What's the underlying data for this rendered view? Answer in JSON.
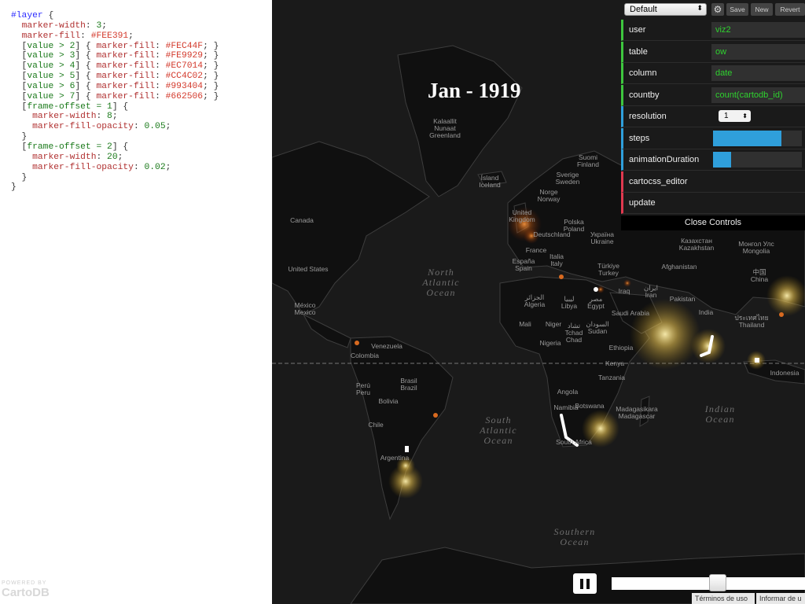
{
  "editor": {
    "lines": [
      [
        [
          "sel",
          "#layer"
        ],
        [
          "pn",
          " {"
        ]
      ],
      [
        [
          "pn",
          "  "
        ],
        [
          "kw",
          "marker-width"
        ],
        [
          "pn",
          ": "
        ],
        [
          "num",
          "3"
        ],
        [
          "pn",
          ";"
        ]
      ],
      [
        [
          "pn",
          "  "
        ],
        [
          "kw",
          "marker-fill"
        ],
        [
          "pn",
          ": "
        ],
        [
          "col",
          "#FEE391"
        ],
        [
          "pn",
          ";"
        ]
      ],
      [
        [
          "pn",
          "  ["
        ],
        [
          "num",
          "value > 2"
        ],
        [
          "pn",
          "] { "
        ],
        [
          "kw",
          "marker-fill"
        ],
        [
          "pn",
          ": "
        ],
        [
          "col",
          "#FEC44F"
        ],
        [
          "pn",
          "; }"
        ]
      ],
      [
        [
          "pn",
          "  ["
        ],
        [
          "num",
          "value > 3"
        ],
        [
          "pn",
          "] { "
        ],
        [
          "kw",
          "marker-fill"
        ],
        [
          "pn",
          ": "
        ],
        [
          "col",
          "#FE9929"
        ],
        [
          "pn",
          "; }"
        ]
      ],
      [
        [
          "pn",
          "  ["
        ],
        [
          "num",
          "value > 4"
        ],
        [
          "pn",
          "] { "
        ],
        [
          "kw",
          "marker-fill"
        ],
        [
          "pn",
          ": "
        ],
        [
          "col",
          "#EC7014"
        ],
        [
          "pn",
          "; }"
        ]
      ],
      [
        [
          "pn",
          "  ["
        ],
        [
          "num",
          "value > 5"
        ],
        [
          "pn",
          "] { "
        ],
        [
          "kw",
          "marker-fill"
        ],
        [
          "pn",
          ": "
        ],
        [
          "col",
          "#CC4C02"
        ],
        [
          "pn",
          "; }"
        ]
      ],
      [
        [
          "pn",
          "  ["
        ],
        [
          "num",
          "value > 6"
        ],
        [
          "pn",
          "] { "
        ],
        [
          "kw",
          "marker-fill"
        ],
        [
          "pn",
          ": "
        ],
        [
          "col",
          "#993404"
        ],
        [
          "pn",
          "; }"
        ]
      ],
      [
        [
          "pn",
          "  ["
        ],
        [
          "num",
          "value > 7"
        ],
        [
          "pn",
          "] { "
        ],
        [
          "kw",
          "marker-fill"
        ],
        [
          "pn",
          ": "
        ],
        [
          "col",
          "#662506"
        ],
        [
          "pn",
          "; }"
        ]
      ],
      [
        [
          "pn",
          "  ["
        ],
        [
          "num",
          "frame-offset = 1"
        ],
        [
          "pn",
          "] {"
        ]
      ],
      [
        [
          "pn",
          "    "
        ],
        [
          "kw",
          "marker-width"
        ],
        [
          "pn",
          ": "
        ],
        [
          "num",
          "8"
        ],
        [
          "pn",
          ";"
        ]
      ],
      [
        [
          "pn",
          "    "
        ],
        [
          "kw",
          "marker-fill-opacity"
        ],
        [
          "pn",
          ": "
        ],
        [
          "num",
          "0.05"
        ],
        [
          "pn",
          ";"
        ]
      ],
      [
        [
          "pn",
          "  }"
        ]
      ],
      [
        [
          "pn",
          "  ["
        ],
        [
          "num",
          "frame-offset = 2"
        ],
        [
          "pn",
          "] {"
        ]
      ],
      [
        [
          "pn",
          "    "
        ],
        [
          "kw",
          "marker-width"
        ],
        [
          "pn",
          ": "
        ],
        [
          "num",
          "20"
        ],
        [
          "pn",
          ";"
        ]
      ],
      [
        [
          "pn",
          "    "
        ],
        [
          "kw",
          "marker-fill-opacity"
        ],
        [
          "pn",
          ": "
        ],
        [
          "num",
          "0.02"
        ],
        [
          "pn",
          ";"
        ]
      ],
      [
        [
          "pn",
          "  }"
        ]
      ],
      [
        [
          "pn",
          "}"
        ]
      ]
    ],
    "brand_small": "POWERED BY",
    "brand_name": "CartoDB"
  },
  "map": {
    "date_title": "Jan - 1919",
    "labels": [
      "Kalaallit\nNunaat\nGreenland",
      "Ísland\nIceland",
      "Suomi\nFinland",
      "Sverige\nSweden",
      "Norge\nNorway",
      "United\nKingdom",
      "Polska\nPoland",
      "Deutschland",
      "Україна\nUkraine",
      "France",
      "Italia\nItaly",
      "España\nSpain",
      "Türkiye\nTurkey",
      "Canada",
      "United States",
      "México\nMexico",
      "الجزائر\nAlgeria",
      "ليبيا\nLibya",
      "مصر\nEgypt",
      "Mali",
      "Niger",
      "تشاد\nTchad\nChad",
      "السودان\nSudan",
      "Nigeria",
      "Ethiopia",
      "Kenya",
      "Tanzania",
      "Angola",
      "Namibia",
      "Botswana",
      "South Africa",
      "Madagasikara\nMadagascar",
      "Venezuela",
      "Colombia",
      "Perú\nPeru",
      "Brasil\nBrazil",
      "Bolivia",
      "Chile",
      "Argentina",
      "Iraq",
      "ایران\nIran",
      "Saudi Arabia",
      "Afghanistan",
      "Pakistan",
      "India",
      "Казахстан\nKazakhstan",
      "Монгол Улс\nMongolia",
      "中国\nChina",
      "ประเทศไทย\nThailand",
      "Indonesia"
    ],
    "oceans": [
      "North\nAtlantic\nOcean",
      "South\nAtlantic\nOcean",
      "Indian\nOcean",
      "Southern\nOcean"
    ]
  },
  "controls": {
    "preset": "Default",
    "save": "Save",
    "new": "New",
    "revert": "Revert",
    "rows": [
      {
        "name": "user",
        "value": "viz2",
        "accent": "#3ec63e"
      },
      {
        "name": "table",
        "value": "ow",
        "accent": "#3ec63e"
      },
      {
        "name": "column",
        "value": "date",
        "accent": "#3ec63e"
      },
      {
        "name": "countby",
        "value": "count(cartodb_id)",
        "accent": "#3ec63e"
      },
      {
        "name": "resolution",
        "value": "1",
        "accent": "#2f9fdb"
      },
      {
        "name": "steps",
        "level": 0.77,
        "accent": "#2f9fdb"
      },
      {
        "name": "animationDuration",
        "level": 0.2,
        "accent": "#2f9fdb"
      },
      {
        "name": "cartocss_editor",
        "accent": "#e0394f"
      },
      {
        "name": "update",
        "accent": "#e0394f"
      }
    ],
    "close_label": "Close Controls"
  },
  "playback": {
    "pause_icon": "pause-icon",
    "progress": 0.55
  },
  "footer": {
    "terms": "Términos de uso",
    "report": "Informar de u"
  }
}
